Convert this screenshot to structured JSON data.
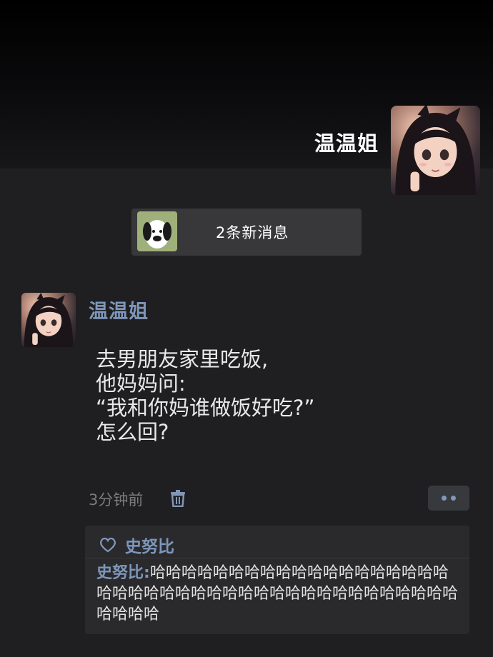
{
  "cover": {
    "name": "温温姐"
  },
  "notice": {
    "text": "2条新消息"
  },
  "post": {
    "author": "温温姐",
    "content": [
      "去男朋友家里吃饭,",
      "他妈妈问:",
      "“我和你妈谁做饭好吃?”",
      "怎么回?"
    ],
    "time": "3分钟前"
  },
  "likes": {
    "names": "史努比"
  },
  "comments": [
    {
      "author": "史努比:",
      "text": "哈哈哈哈哈哈哈哈哈哈哈哈哈哈哈哈哈哈哈哈哈哈哈哈哈哈哈哈哈哈哈哈哈哈哈哈哈哈哈哈哈哈哈哈哈哈"
    }
  ],
  "colors": {
    "link": "#7e96ba",
    "background": "#1f1f21"
  },
  "icons": {
    "delete": "trash-icon",
    "like": "heart-icon",
    "more": "more-dots-icon"
  }
}
